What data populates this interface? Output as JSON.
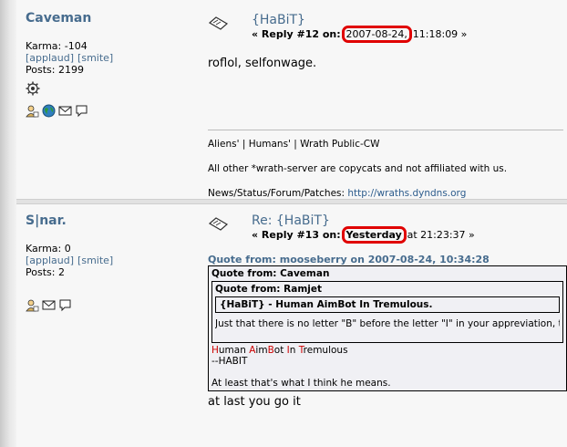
{
  "posts": [
    {
      "poster": "Caveman",
      "karma": "Karma: -104",
      "applaud": "[applaud]",
      "smite": "[smite]",
      "posts": "Posts: 2199",
      "subject": "{HaBiT}",
      "reply_prefix": "« Reply #12 on:",
      "date": "2007-08-24,",
      "time": "11:18:09 »",
      "body": "roflol, selfonwage.",
      "signature": {
        "line1": "Aliens' | Humans' | Wrath Public-CW",
        "line2": "All other *wrath-server are copycats and not affiliated with us.",
        "line3_label": "News/Status/Forum/Patches:",
        "line3_link": "http://wraths.dyndns.org"
      }
    },
    {
      "poster": "S|nar.",
      "karma": "Karma: 0",
      "applaud": "[applaud]",
      "smite": "[smite]",
      "posts": "Posts: 2",
      "subject": "Re: {HaBiT}",
      "reply_prefix": "« Reply #13 on:",
      "date": "Yesterday",
      "time": "at 21:23:37 »",
      "quote": {
        "header": "Quote from: mooseberry on 2007-08-24, 10:34:28",
        "from_caveman": "Quote from: Caveman",
        "from_ramjet": "Quote from: Ramjet",
        "title": "{HaBiT} - Human AimBot In Tremulous.",
        "letter_line": "Just that there is no letter \"B\" before the letter \"I\" in your appreviation, thu",
        "acro": [
          "H",
          "uman ",
          "A",
          "im",
          "B",
          "ot ",
          "I",
          "n ",
          "T",
          "remulous"
        ],
        "habit": "--HABIT",
        "think": "At least that's what I think he means."
      },
      "body": "at last you go it"
    }
  ],
  "colors": {
    "link": "#476c8e",
    "highlight": "#e00000"
  },
  "icons": [
    "gear-icon",
    "profile-icon",
    "globe-icon",
    "email-icon",
    "pm-icon",
    "topic-icon"
  ]
}
